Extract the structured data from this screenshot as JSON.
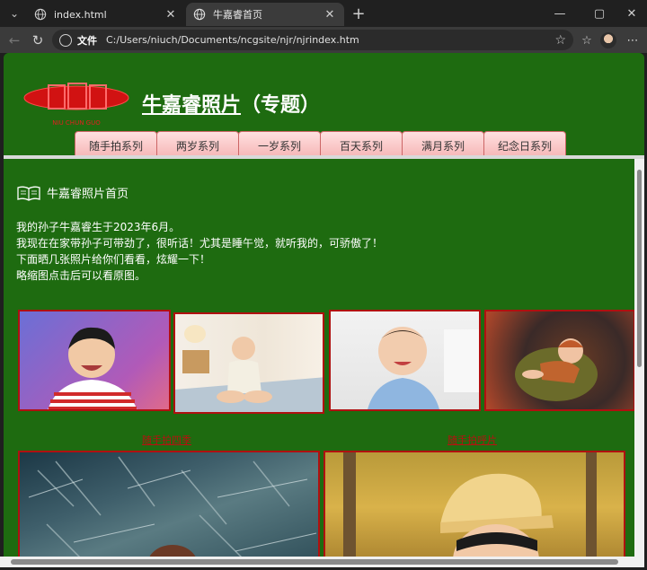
{
  "browser": {
    "tabs": [
      {
        "title": "index.html",
        "active": false
      },
      {
        "title": "牛嘉睿首页",
        "active": true
      }
    ],
    "address": {
      "scheme_label": "文件",
      "url": "C:/Users/niuch/Documents/ncgsite/njr/njrindex.htm"
    }
  },
  "page": {
    "logo_text": "NIU CHUN GUO",
    "title_link": "牛嘉睿照片",
    "title_suffix": "（专题）",
    "nav_tabs": [
      "随手拍系列",
      "两岁系列",
      "一岁系列",
      "百天系列",
      "满月系列",
      "纪念日系列"
    ],
    "breadcrumb": "牛嘉睿照片首页",
    "intro_lines": [
      "我的孙子牛嘉睿生于2023年6月。",
      "我现在在家带孙子可带劲了，很听话！尤其是睡午觉，就听我的，可骄傲了！",
      "下面晒几张照片给你们看看，炫耀一下！",
      "略缩图点击后可以看原图。"
    ],
    "captions": [
      "随手拍四季",
      "随手拍呼片"
    ]
  },
  "colors": {
    "page_bg": "#1e6b10",
    "photo_border": "#b01010",
    "tab_fill": "#f6b8b8"
  }
}
